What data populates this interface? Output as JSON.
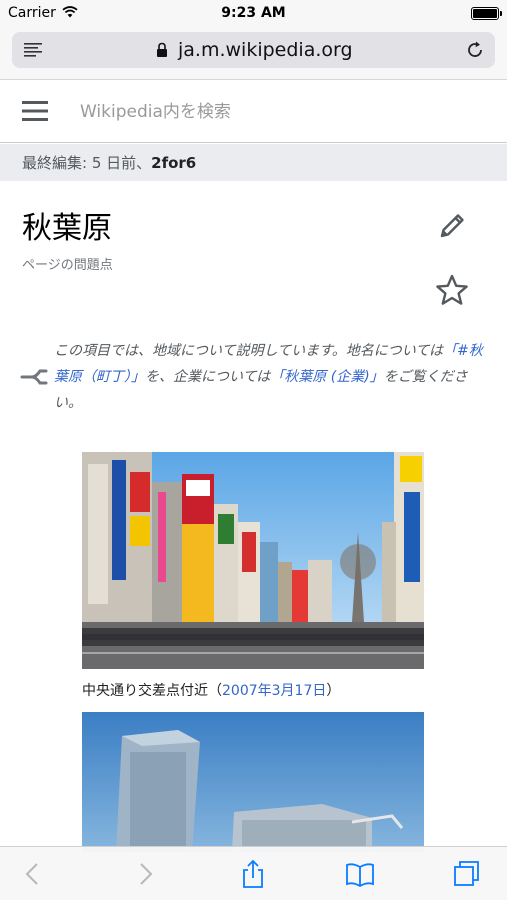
{
  "status": {
    "carrier": "Carrier",
    "time": "9:23 AM"
  },
  "browser": {
    "url": "ja.m.wikipedia.org"
  },
  "header": {
    "search_placeholder": "Wikipedia内を検索"
  },
  "last_modified": {
    "prefix": "最終編集: 5 日前、",
    "user": "2for6"
  },
  "page": {
    "title": "秋葉原",
    "issues_link": "ページの問題点"
  },
  "hatnote": {
    "part1": "この項目では、地域について説明しています。地名については",
    "link1": "「#秋葉原（町丁）」",
    "part2": "を、企業については",
    "link2": "「秋葉原 (企業)」",
    "part3": "をご覧ください。"
  },
  "figure1": {
    "caption_text": "中央通り交差点付近（",
    "caption_link": "2007年3月17日",
    "caption_end": "）"
  },
  "colors": {
    "link": "#3366cc",
    "ios_blue": "#0a7cff",
    "disabled": "#b8b8b8"
  },
  "icons": [
    "wifi-icon",
    "battery-icon",
    "reader-icon",
    "lock-icon",
    "reload-icon",
    "menu-icon",
    "edit-icon",
    "star-icon",
    "disambiguation-icon",
    "back-icon",
    "forward-icon",
    "share-icon",
    "bookmarks-icon",
    "tabs-icon"
  ]
}
